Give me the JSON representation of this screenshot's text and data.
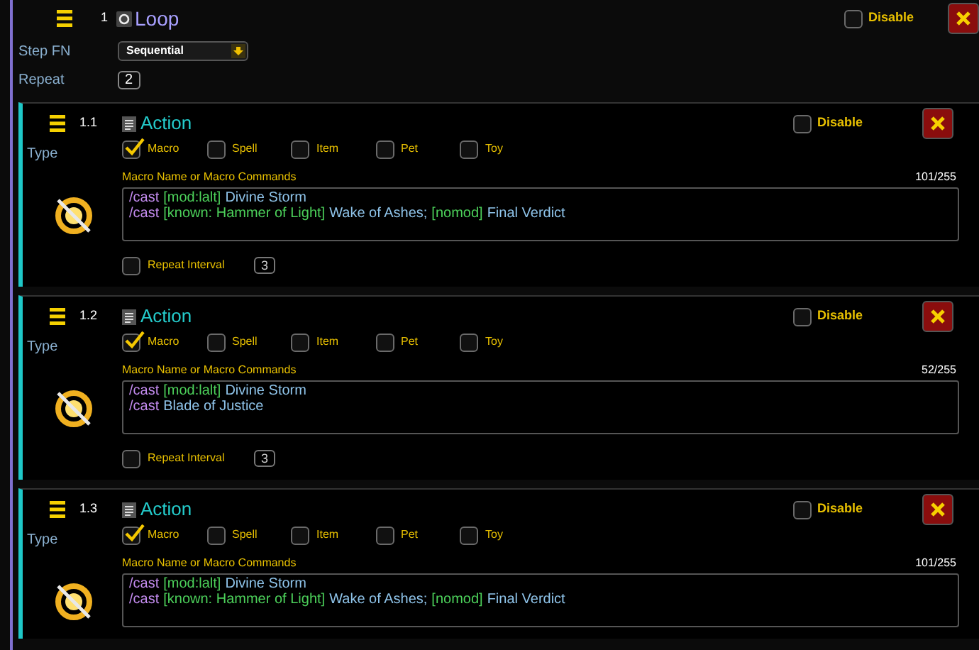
{
  "loop": {
    "index": "1",
    "title": "Loop",
    "disable": {
      "label": "Disable",
      "checked": false
    },
    "step_fn": {
      "label": "Step FN",
      "value": "Sequential"
    },
    "repeat": {
      "label": "Repeat",
      "value": "2"
    }
  },
  "actions": [
    {
      "index": "1.1",
      "title": "Action",
      "disable": {
        "label": "Disable",
        "checked": false
      },
      "type_label": "Type",
      "types": [
        {
          "label": "Macro",
          "selected": true
        },
        {
          "label": "Spell",
          "selected": false
        },
        {
          "label": "Item",
          "selected": false
        },
        {
          "label": "Pet",
          "selected": false
        },
        {
          "label": "Toy",
          "selected": false
        }
      ],
      "macro_label": "Macro Name or Macro Commands",
      "counter": "101/255",
      "lines": [
        [
          {
            "kind": "command",
            "text": "/cast"
          },
          {
            "kind": "condition",
            "text": "[mod:lalt]"
          },
          {
            "kind": "spell",
            "text": "Divine Storm"
          }
        ],
        [
          {
            "kind": "command",
            "text": "/cast"
          },
          {
            "kind": "condition",
            "text": "[known: Hammer of Light]"
          },
          {
            "kind": "spell",
            "text": "Wake of Ashes;"
          },
          {
            "kind": "condition",
            "text": "[nomod]"
          },
          {
            "kind": "spell",
            "text": "Final Verdict"
          }
        ]
      ],
      "repeat_interval": {
        "label": "Repeat Interval",
        "checked": false,
        "value": "3"
      }
    },
    {
      "index": "1.2",
      "title": "Action",
      "disable": {
        "label": "Disable",
        "checked": false
      },
      "type_label": "Type",
      "types": [
        {
          "label": "Macro",
          "selected": true
        },
        {
          "label": "Spell",
          "selected": false
        },
        {
          "label": "Item",
          "selected": false
        },
        {
          "label": "Pet",
          "selected": false
        },
        {
          "label": "Toy",
          "selected": false
        }
      ],
      "macro_label": "Macro Name or Macro Commands",
      "counter": "52/255",
      "lines": [
        [
          {
            "kind": "command",
            "text": "/cast"
          },
          {
            "kind": "condition",
            "text": "[mod:lalt]"
          },
          {
            "kind": "spell",
            "text": "Divine Storm"
          }
        ],
        [
          {
            "kind": "command",
            "text": "/cast"
          },
          {
            "kind": "spell",
            "text": "Blade of Justice"
          }
        ]
      ],
      "repeat_interval": {
        "label": "Repeat Interval",
        "checked": false,
        "value": "3"
      }
    },
    {
      "index": "1.3",
      "title": "Action",
      "disable": {
        "label": "Disable",
        "checked": false
      },
      "type_label": "Type",
      "types": [
        {
          "label": "Macro",
          "selected": true
        },
        {
          "label": "Spell",
          "selected": false
        },
        {
          "label": "Item",
          "selected": false
        },
        {
          "label": "Pet",
          "selected": false
        },
        {
          "label": "Toy",
          "selected": false
        }
      ],
      "macro_label": "Macro Name or Macro Commands",
      "counter": "101/255",
      "lines": [
        [
          {
            "kind": "command",
            "text": "/cast"
          },
          {
            "kind": "condition",
            "text": "[mod:lalt]"
          },
          {
            "kind": "spell",
            "text": "Divine Storm"
          }
        ],
        [
          {
            "kind": "command",
            "text": "/cast"
          },
          {
            "kind": "condition",
            "text": "[known: Hammer of Light]"
          },
          {
            "kind": "spell",
            "text": "Wake of Ashes;"
          },
          {
            "kind": "condition",
            "text": "[nomod]"
          },
          {
            "kind": "spell",
            "text": "Final Verdict"
          }
        ]
      ]
    }
  ]
}
